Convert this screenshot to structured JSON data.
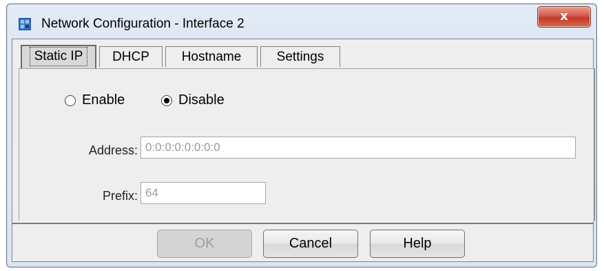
{
  "window": {
    "title": "Network Configuration - Interface 2",
    "close_label": "x"
  },
  "tabs": [
    {
      "label": "Static IP",
      "active": true
    },
    {
      "label": "DHCP",
      "active": false
    },
    {
      "label": "Hostname",
      "active": false
    },
    {
      "label": "Settings",
      "active": false
    }
  ],
  "static_ip": {
    "enable_label": "Enable",
    "disable_label": "Disable",
    "selected": "Disable",
    "address_label": "Address:",
    "address_value": "0:0:0:0:0:0:0:0",
    "prefix_label": "Prefix:",
    "prefix_value": "64"
  },
  "buttons": {
    "ok_label": "OK",
    "cancel_label": "Cancel",
    "help_label": "Help"
  },
  "colors": {
    "close_button": "#c03a2b",
    "app_icon": "#2a5fae"
  },
  "icons": {
    "app": "network-app-icon",
    "close": "close-icon"
  }
}
